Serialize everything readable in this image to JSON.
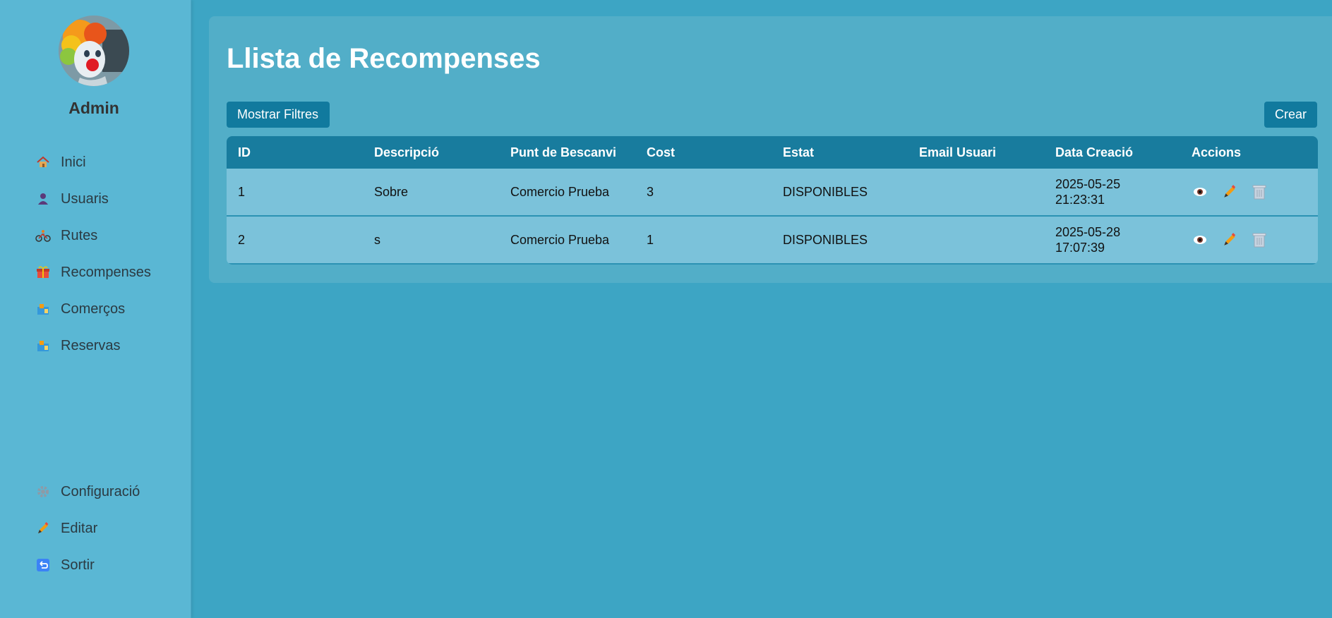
{
  "sidebar": {
    "username": "Admin",
    "items": [
      {
        "label": "Inici",
        "icon": "home-icon"
      },
      {
        "label": "Usuaris",
        "icon": "user-icon"
      },
      {
        "label": "Rutes",
        "icon": "bicycle-icon"
      },
      {
        "label": "Recompenses",
        "icon": "gift-icon"
      },
      {
        "label": "Comerços",
        "icon": "shop-icon"
      },
      {
        "label": "Reservas",
        "icon": "shop-icon"
      }
    ],
    "bottom_items": [
      {
        "label": "Configuració",
        "icon": "gear-icon"
      },
      {
        "label": "Editar",
        "icon": "pencil-icon"
      },
      {
        "label": "Sortir",
        "icon": "return-icon"
      }
    ]
  },
  "main": {
    "title": "Llista de Recompenses",
    "filters_button": "Mostrar Filtres",
    "create_button": "Crear"
  },
  "table": {
    "headers": [
      "ID",
      "Descripció",
      "Punt de Bescanvi",
      "Cost",
      "Estat",
      "Email Usuari",
      "Data Creació",
      "Accions"
    ],
    "rows": [
      {
        "id": "1",
        "descripcio": "Sobre",
        "punt": "Comercio Prueba",
        "cost": "3",
        "estat": "DISPONIBLES",
        "email": "",
        "data_l1": "2025-05-25",
        "data_l2": "21:23:31"
      },
      {
        "id": "2",
        "descripcio": "s",
        "punt": "Comercio Prueba",
        "cost": "1",
        "estat": "DISPONIBLES",
        "email": "",
        "data_l1": "2025-05-28",
        "data_l2": "17:07:39"
      }
    ]
  },
  "colors": {
    "background": "#3da5c4",
    "sidebar": "#5ab7d4",
    "panel": "#52aec8",
    "header": "#187c9e",
    "row": "#7bc2da",
    "button": "#117a9e"
  }
}
